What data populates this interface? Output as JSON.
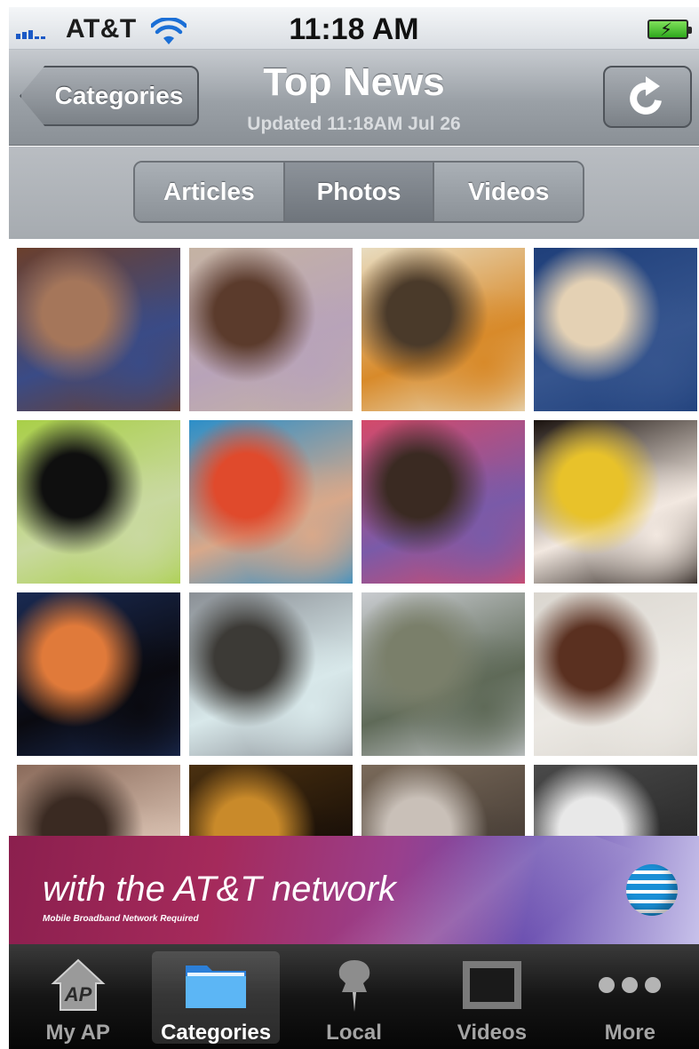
{
  "status_bar": {
    "carrier": "AT&T",
    "time": "11:18 AM"
  },
  "nav": {
    "back_label": "Categories",
    "title": "Top News",
    "subtitle": "Updated 11:18AM Jul 26"
  },
  "segments": [
    {
      "label": "Articles",
      "selected": false
    },
    {
      "label": "Photos",
      "selected": true
    },
    {
      "label": "Videos",
      "selected": false
    }
  ],
  "photos": [
    {
      "name": "photo-malnourished-child",
      "colors": [
        "#6b3f2c",
        "#a5765a",
        "#3a4b86"
      ]
    },
    {
      "name": "photo-hands-on-bed",
      "colors": [
        "#c5b3a3",
        "#5b3b2c",
        "#b8a3b9"
      ]
    },
    {
      "name": "photo-memorial-candles",
      "colors": [
        "#e8dcc0",
        "#4a3a2a",
        "#d88a2a"
      ]
    },
    {
      "name": "photo-officials-walking",
      "colors": [
        "#1f3f7a",
        "#e4d1b4",
        "#36558e"
      ]
    },
    {
      "name": "photo-woman-green-scarf",
      "colors": [
        "#a9cf48",
        "#0f0f0f",
        "#c9d9a0"
      ]
    },
    {
      "name": "photo-swimmer-goggles",
      "colors": [
        "#2c8fc9",
        "#e04a2c",
        "#d8a88a"
      ]
    },
    {
      "name": "photo-flowers-mirror",
      "colors": [
        "#d44a6a",
        "#3a2a22",
        "#7a5aa8"
      ]
    },
    {
      "name": "photo-painted-face",
      "colors": [
        "#1a120e",
        "#e8c22a",
        "#f2e8e0"
      ]
    },
    {
      "name": "photo-windmill-sunset",
      "colors": [
        "#1a2a52",
        "#e07a3a",
        "#0a0a10"
      ]
    },
    {
      "name": "photo-coastal-waves",
      "colors": [
        "#8a8f95",
        "#3c3a36",
        "#d8e8ea"
      ]
    },
    {
      "name": "photo-train-bridge",
      "colors": [
        "#c9ccd0",
        "#7a7f6a",
        "#5f6a58"
      ]
    },
    {
      "name": "photo-child-on-sheet",
      "colors": [
        "#dad6cf",
        "#5a3020",
        "#ece9e4"
      ]
    },
    {
      "name": "photo-crowd-grief",
      "colors": [
        "#8a6a5a",
        "#3a2a22",
        "#d8c0b0"
      ]
    },
    {
      "name": "photo-candle-crowd",
      "colors": [
        "#4a3010",
        "#c98a2a",
        "#1a1008"
      ]
    },
    {
      "name": "photo-men-gathering",
      "colors": [
        "#7a6a5a",
        "#c9c0b8",
        "#4a4038"
      ]
    },
    {
      "name": "photo-baseball-crowd",
      "colors": [
        "#4a4a4a",
        "#e8e8e8",
        "#2a2a2a"
      ]
    }
  ],
  "ad": {
    "headline": "with the AT&T network",
    "fineprint": "Mobile Broadband Network Required"
  },
  "tabs": [
    {
      "label": "My AP",
      "icon": "ap-house-icon",
      "selected": false
    },
    {
      "label": "Categories",
      "icon": "folder-icon",
      "selected": true
    },
    {
      "label": "Local",
      "icon": "pushpin-icon",
      "selected": false
    },
    {
      "label": "Videos",
      "icon": "film-icon",
      "selected": false
    },
    {
      "label": "More",
      "icon": "ellipsis-icon",
      "selected": false
    }
  ]
}
